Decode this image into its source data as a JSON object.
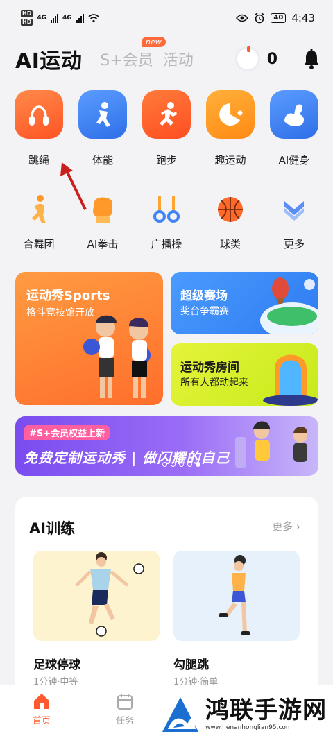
{
  "status_bar": {
    "hd_labels": [
      "HD",
      "HD"
    ],
    "network": [
      "4G",
      "4G"
    ],
    "battery": "40",
    "time": "4:43"
  },
  "header": {
    "title": "AI运动",
    "tabs": [
      {
        "label": "S+会员",
        "badge": "new"
      },
      {
        "label": "活动"
      }
    ],
    "score": "0",
    "icons": {
      "score_ring": "progress-ring-icon",
      "bell": "bell-icon"
    }
  },
  "features": {
    "row1": [
      {
        "label": "跳绳",
        "icon": "jump-rope-icon",
        "color": "#ff5a2d"
      },
      {
        "label": "体能",
        "icon": "fitness-runner-icon",
        "color": "#3f84f5"
      },
      {
        "label": "跑步",
        "icon": "running-icon",
        "color": "#ff5a2d"
      },
      {
        "label": "趣运动",
        "icon": "fun-sport-icon",
        "color": "#ff9820"
      },
      {
        "label": "AI健身",
        "icon": "muscle-arm-icon",
        "color": "#3f84f5"
      }
    ],
    "row2": [
      {
        "label": "合舞团",
        "icon": "dance-icon"
      },
      {
        "label": "AI拳击",
        "icon": "boxing-glove-icon"
      },
      {
        "label": "广播操",
        "icon": "gymnastics-rings-icon"
      },
      {
        "label": "球类",
        "icon": "basketball-icon"
      },
      {
        "label": "更多",
        "icon": "more-chevron-icon"
      }
    ]
  },
  "banners": {
    "sports_show": {
      "title": "运动秀Sports",
      "subtitle": "格斗竞技馆开放"
    },
    "super_arena": {
      "title": "超级赛场",
      "subtitle": "奖台争霸赛"
    },
    "show_room": {
      "title": "运动秀房间",
      "subtitle": "所有人都动起来"
    },
    "promo": {
      "tag": "#S+会员权益上新",
      "text": "免费定制运动秀 | 做闪耀的自己",
      "dots": 5,
      "active_dot": 4
    }
  },
  "ai_training": {
    "title": "AI训练",
    "more": "更多",
    "items": [
      {
        "name": "足球停球",
        "meta": "1分钟·中等"
      },
      {
        "name": "勾腿跳",
        "meta": "1分钟·简单"
      }
    ]
  },
  "bottom_nav": [
    {
      "label": "首页",
      "icon": "home-icon",
      "active": true
    },
    {
      "label": "任务",
      "icon": "calendar-icon",
      "active": false
    }
  ],
  "watermark": {
    "brand": "鸿联手游网",
    "url": "www.henanhonglian95.com"
  },
  "colors": {
    "accent": "#ff5a2d",
    "blue": "#3f84f5",
    "orange": "#ff9820"
  }
}
